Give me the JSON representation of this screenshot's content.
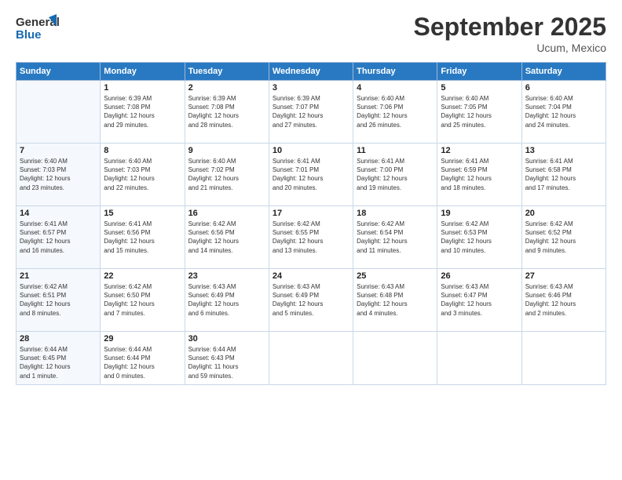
{
  "header": {
    "logo_line1": "General",
    "logo_line2": "Blue",
    "month": "September 2025",
    "location": "Ucum, Mexico"
  },
  "days_of_week": [
    "Sunday",
    "Monday",
    "Tuesday",
    "Wednesday",
    "Thursday",
    "Friday",
    "Saturday"
  ],
  "weeks": [
    [
      {
        "num": "",
        "info": ""
      },
      {
        "num": "1",
        "info": "Sunrise: 6:39 AM\nSunset: 7:08 PM\nDaylight: 12 hours\nand 29 minutes."
      },
      {
        "num": "2",
        "info": "Sunrise: 6:39 AM\nSunset: 7:08 PM\nDaylight: 12 hours\nand 28 minutes."
      },
      {
        "num": "3",
        "info": "Sunrise: 6:39 AM\nSunset: 7:07 PM\nDaylight: 12 hours\nand 27 minutes."
      },
      {
        "num": "4",
        "info": "Sunrise: 6:40 AM\nSunset: 7:06 PM\nDaylight: 12 hours\nand 26 minutes."
      },
      {
        "num": "5",
        "info": "Sunrise: 6:40 AM\nSunset: 7:05 PM\nDaylight: 12 hours\nand 25 minutes."
      },
      {
        "num": "6",
        "info": "Sunrise: 6:40 AM\nSunset: 7:04 PM\nDaylight: 12 hours\nand 24 minutes."
      }
    ],
    [
      {
        "num": "7",
        "info": "Sunrise: 6:40 AM\nSunset: 7:03 PM\nDaylight: 12 hours\nand 23 minutes."
      },
      {
        "num": "8",
        "info": "Sunrise: 6:40 AM\nSunset: 7:03 PM\nDaylight: 12 hours\nand 22 minutes."
      },
      {
        "num": "9",
        "info": "Sunrise: 6:40 AM\nSunset: 7:02 PM\nDaylight: 12 hours\nand 21 minutes."
      },
      {
        "num": "10",
        "info": "Sunrise: 6:41 AM\nSunset: 7:01 PM\nDaylight: 12 hours\nand 20 minutes."
      },
      {
        "num": "11",
        "info": "Sunrise: 6:41 AM\nSunset: 7:00 PM\nDaylight: 12 hours\nand 19 minutes."
      },
      {
        "num": "12",
        "info": "Sunrise: 6:41 AM\nSunset: 6:59 PM\nDaylight: 12 hours\nand 18 minutes."
      },
      {
        "num": "13",
        "info": "Sunrise: 6:41 AM\nSunset: 6:58 PM\nDaylight: 12 hours\nand 17 minutes."
      }
    ],
    [
      {
        "num": "14",
        "info": "Sunrise: 6:41 AM\nSunset: 6:57 PM\nDaylight: 12 hours\nand 16 minutes."
      },
      {
        "num": "15",
        "info": "Sunrise: 6:41 AM\nSunset: 6:56 PM\nDaylight: 12 hours\nand 15 minutes."
      },
      {
        "num": "16",
        "info": "Sunrise: 6:42 AM\nSunset: 6:56 PM\nDaylight: 12 hours\nand 14 minutes."
      },
      {
        "num": "17",
        "info": "Sunrise: 6:42 AM\nSunset: 6:55 PM\nDaylight: 12 hours\nand 13 minutes."
      },
      {
        "num": "18",
        "info": "Sunrise: 6:42 AM\nSunset: 6:54 PM\nDaylight: 12 hours\nand 11 minutes."
      },
      {
        "num": "19",
        "info": "Sunrise: 6:42 AM\nSunset: 6:53 PM\nDaylight: 12 hours\nand 10 minutes."
      },
      {
        "num": "20",
        "info": "Sunrise: 6:42 AM\nSunset: 6:52 PM\nDaylight: 12 hours\nand 9 minutes."
      }
    ],
    [
      {
        "num": "21",
        "info": "Sunrise: 6:42 AM\nSunset: 6:51 PM\nDaylight: 12 hours\nand 8 minutes."
      },
      {
        "num": "22",
        "info": "Sunrise: 6:42 AM\nSunset: 6:50 PM\nDaylight: 12 hours\nand 7 minutes."
      },
      {
        "num": "23",
        "info": "Sunrise: 6:43 AM\nSunset: 6:49 PM\nDaylight: 12 hours\nand 6 minutes."
      },
      {
        "num": "24",
        "info": "Sunrise: 6:43 AM\nSunset: 6:49 PM\nDaylight: 12 hours\nand 5 minutes."
      },
      {
        "num": "25",
        "info": "Sunrise: 6:43 AM\nSunset: 6:48 PM\nDaylight: 12 hours\nand 4 minutes."
      },
      {
        "num": "26",
        "info": "Sunrise: 6:43 AM\nSunset: 6:47 PM\nDaylight: 12 hours\nand 3 minutes."
      },
      {
        "num": "27",
        "info": "Sunrise: 6:43 AM\nSunset: 6:46 PM\nDaylight: 12 hours\nand 2 minutes."
      }
    ],
    [
      {
        "num": "28",
        "info": "Sunrise: 6:44 AM\nSunset: 6:45 PM\nDaylight: 12 hours\nand 1 minute."
      },
      {
        "num": "29",
        "info": "Sunrise: 6:44 AM\nSunset: 6:44 PM\nDaylight: 12 hours\nand 0 minutes."
      },
      {
        "num": "30",
        "info": "Sunrise: 6:44 AM\nSunset: 6:43 PM\nDaylight: 11 hours\nand 59 minutes."
      },
      {
        "num": "",
        "info": ""
      },
      {
        "num": "",
        "info": ""
      },
      {
        "num": "",
        "info": ""
      },
      {
        "num": "",
        "info": ""
      }
    ]
  ]
}
